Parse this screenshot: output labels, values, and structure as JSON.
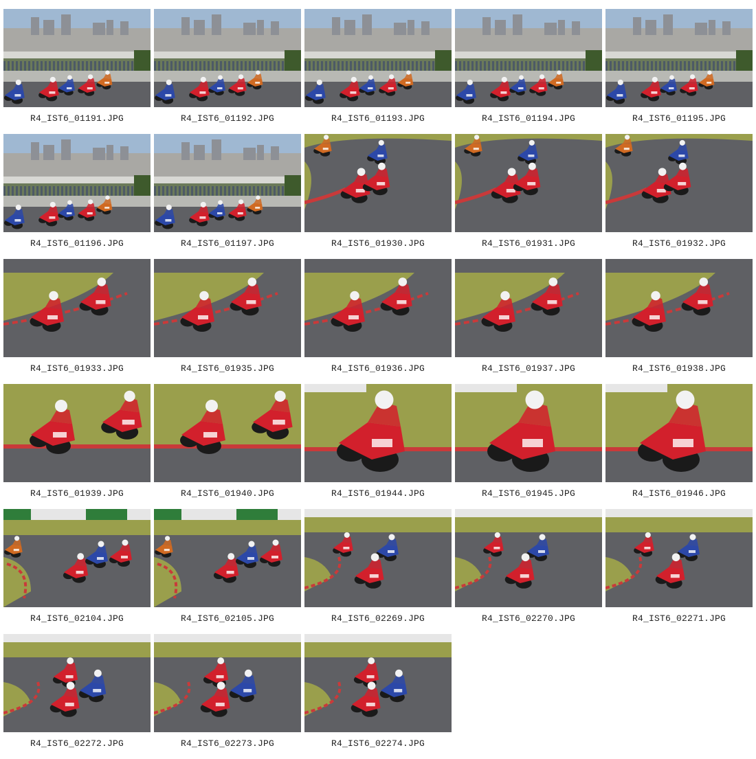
{
  "gallery": {
    "items": [
      {
        "filename": "R4_IST6_01191.JPG",
        "scene": "skyline"
      },
      {
        "filename": "R4_IST6_01192.JPG",
        "scene": "skyline"
      },
      {
        "filename": "R4_IST6_01193.JPG",
        "scene": "skyline"
      },
      {
        "filename": "R4_IST6_01194.JPG",
        "scene": "skyline"
      },
      {
        "filename": "R4_IST6_01195.JPG",
        "scene": "skyline"
      },
      {
        "filename": "R4_IST6_01196.JPG",
        "scene": "skyline"
      },
      {
        "filename": "R4_IST6_01197.JPG",
        "scene": "skyline"
      },
      {
        "filename": "R4_IST6_01930.JPG",
        "scene": "corner"
      },
      {
        "filename": "R4_IST6_01931.JPG",
        "scene": "corner"
      },
      {
        "filename": "R4_IST6_01932.JPG",
        "scene": "corner"
      },
      {
        "filename": "R4_IST6_01933.JPG",
        "scene": "pair"
      },
      {
        "filename": "R4_IST6_01935.JPG",
        "scene": "pair"
      },
      {
        "filename": "R4_IST6_01936.JPG",
        "scene": "pair"
      },
      {
        "filename": "R4_IST6_01937.JPG",
        "scene": "pair"
      },
      {
        "filename": "R4_IST6_01938.JPG",
        "scene": "pair"
      },
      {
        "filename": "R4_IST6_01939.JPG",
        "scene": "closepair"
      },
      {
        "filename": "R4_IST6_01940.JPG",
        "scene": "closepair"
      },
      {
        "filename": "R4_IST6_01944.JPG",
        "scene": "closeup"
      },
      {
        "filename": "R4_IST6_01945.JPG",
        "scene": "closeup"
      },
      {
        "filename": "R4_IST6_01946.JPG",
        "scene": "closeup"
      },
      {
        "filename": "R4_IST6_02104.JPG",
        "scene": "group"
      },
      {
        "filename": "R4_IST6_02105.JPG",
        "scene": "group"
      },
      {
        "filename": "R4_IST6_02269.JPG",
        "scene": "chase"
      },
      {
        "filename": "R4_IST6_02270.JPG",
        "scene": "chase"
      },
      {
        "filename": "R4_IST6_02271.JPG",
        "scene": "chase"
      },
      {
        "filename": "R4_IST6_02272.JPG",
        "scene": "chase2"
      },
      {
        "filename": "R4_IST6_02273.JPG",
        "scene": "chase2"
      },
      {
        "filename": "R4_IST6_02274.JPG",
        "scene": "chase2"
      }
    ]
  },
  "colors": {
    "sky": "#9fb8d2",
    "grass": "#9a9f4c",
    "asphalt": "#5f6064",
    "bike_red": "#d2202c",
    "bike_blue": "#2c48a8",
    "bike_orange": "#d06a22",
    "bike_green": "#2a8a3a",
    "kerb_red": "#c93a3a",
    "caption_text": "#222222"
  }
}
